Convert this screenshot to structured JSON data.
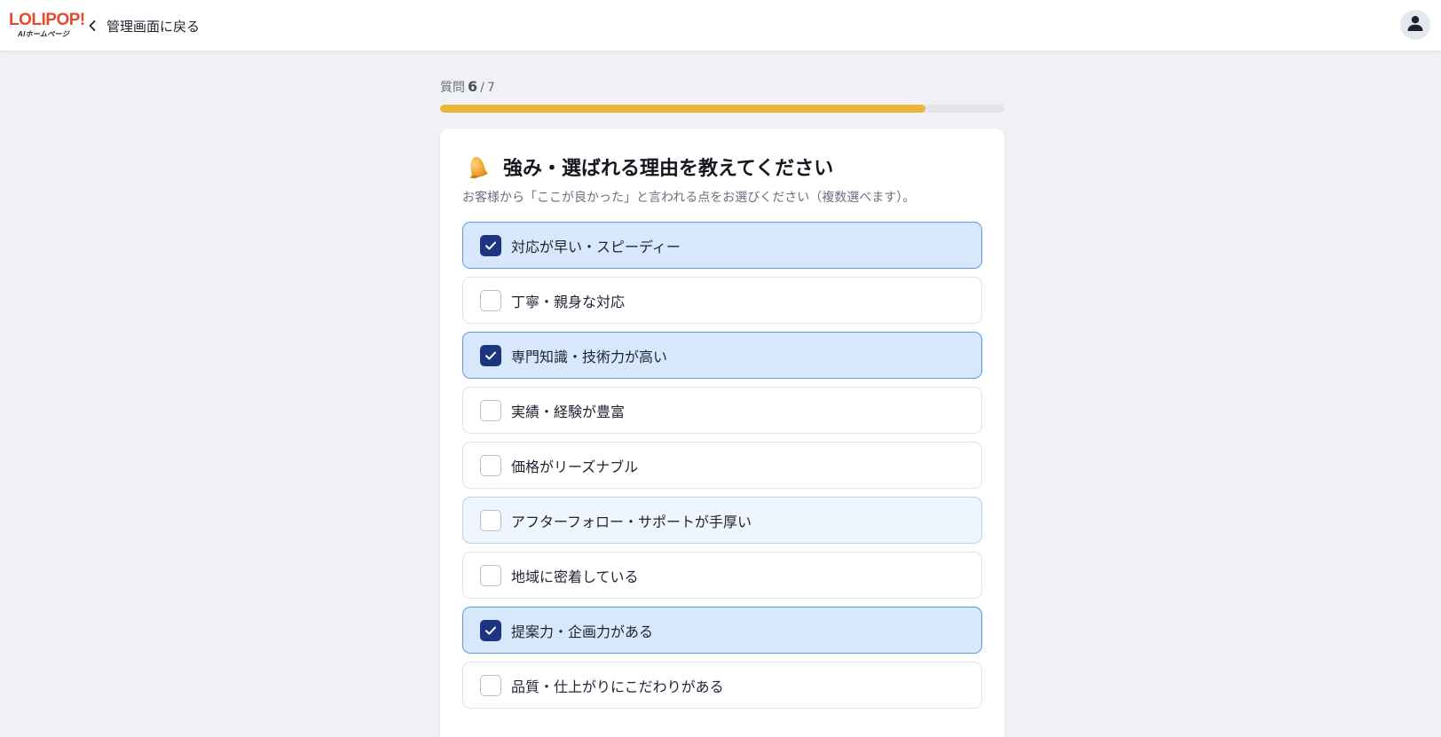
{
  "header": {
    "logo_main": "LOLIPOP!",
    "logo_sub": "AIホームページ",
    "back_label": "管理画面に戻る",
    "icons": {
      "back": "chevron-left-icon",
      "user": "user-icon"
    }
  },
  "progress": {
    "prefix": "質問",
    "current": "6",
    "separator": "/",
    "total": "7",
    "fill_fraction": 0.86,
    "fill_color": "#e9b63b"
  },
  "question": {
    "icon": "bell-icon",
    "title": "強み・選ばれる理由を教えてください",
    "description": "お客様から「ここが良かった」と言われる点をお選びください（複数選べます）。",
    "options": [
      {
        "label": "対応が早い・スピーディー",
        "checked": true
      },
      {
        "label": "丁寧・親身な対応",
        "checked": false
      },
      {
        "label": "専門知識・技術力が高い",
        "checked": true
      },
      {
        "label": "実績・経験が豊富",
        "checked": false
      },
      {
        "label": "価格がリーズナブル",
        "checked": false
      },
      {
        "label": "アフターフォロー・サポートが手厚い",
        "checked": false,
        "hover": true
      },
      {
        "label": "地域に密着している",
        "checked": false
      },
      {
        "label": "提案力・企画力がある",
        "checked": true
      },
      {
        "label": "品質・仕上がりにこだわりがある",
        "checked": false
      }
    ]
  },
  "colors": {
    "accent": "#1d3580",
    "selected_bg": "#d7e8fc",
    "selected_border": "#5b9ae6",
    "brand": "#e64a2e"
  }
}
